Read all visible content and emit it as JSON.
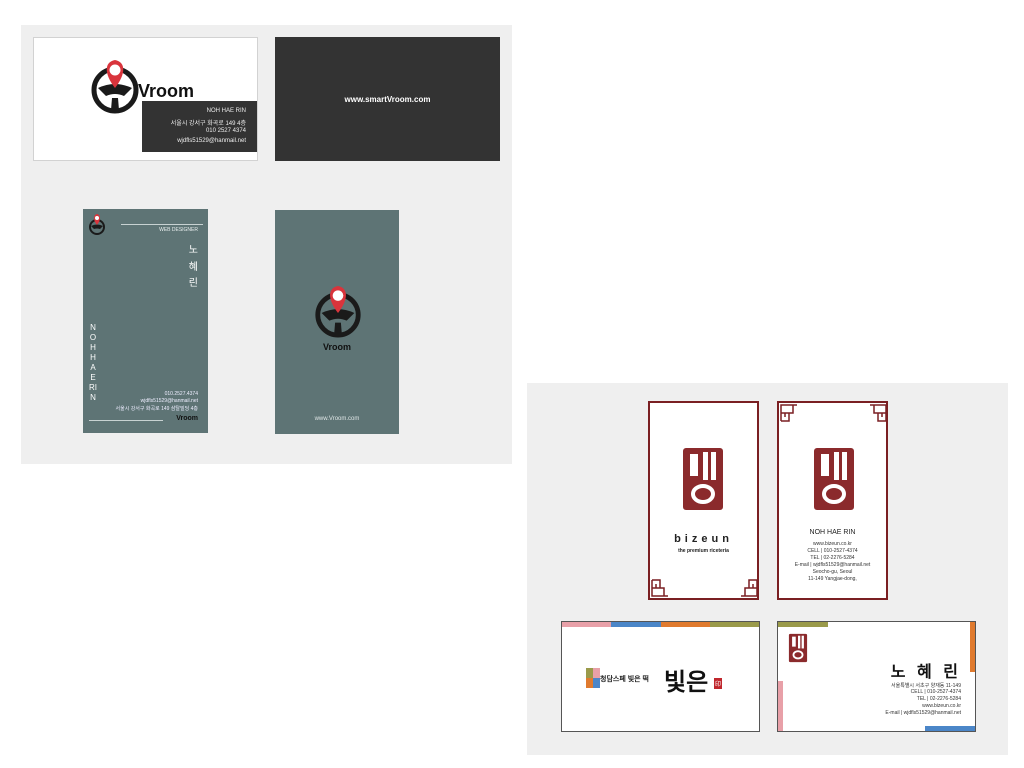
{
  "vroom": {
    "brand": "Vroom",
    "brand_color": "#d9343c",
    "dark_color": "#333333",
    "teal_color": "#5e7475",
    "front": {
      "name": "NOH HAE RIN",
      "address": "서울시 강서구 화곡로 149 4층",
      "phone": "010 2527 4374",
      "email": "wjdfls51529@hanmail.net"
    },
    "back": {
      "website": "www.smartVroom.com"
    },
    "vertical_front": {
      "title": "WEB DESIGNER",
      "name_korean": [
        "노",
        "혜",
        "린"
      ],
      "name_english": "NOHHAERIN",
      "phone": "010.2527.4374",
      "email": "wjdfls51529@hanmail.net",
      "address": "서울시 강서구 화곡로 149 삼탈빌딩 4층",
      "brand": "Vroom"
    },
    "vertical_back": {
      "brand": "Vroom",
      "website": "www.Vroom.com"
    }
  },
  "bizeun": {
    "brand_color": "#7a1f22",
    "seal_text": "빛은",
    "front": {
      "brand": "bizeun",
      "tagline": "the premium riceteria"
    },
    "back": {
      "name": "NOH HAE RIN",
      "website": "www.bizeun.co.kr",
      "cell": "CELL | 010-2527-4374",
      "tel": "TEL | 02-2276-5284",
      "email": "E-mail | wjdfls51529@hanmail.net",
      "address1": "Seocho-gu, Seoul",
      "address2": "11-149 Yangjae-dong,"
    },
    "horizontal_front": {
      "subtitle": "청담스페 빛은 떡",
      "logo": "빛은",
      "stamp": "印"
    },
    "horizontal_back": {
      "name": "노 혜 린",
      "address": "서울특별시 서초구 양재동 11-149",
      "cell": "CELL | 010-2527-4374",
      "tel": "TEL | 02-2276-5284",
      "website": "www.bizeun.co.kr",
      "email": "E-mail | wjdfls51529@hanmail.net"
    },
    "stripe_colors": [
      "#e8a0a8",
      "#4b86c8",
      "#e07a2e",
      "#9a9a4a"
    ]
  }
}
